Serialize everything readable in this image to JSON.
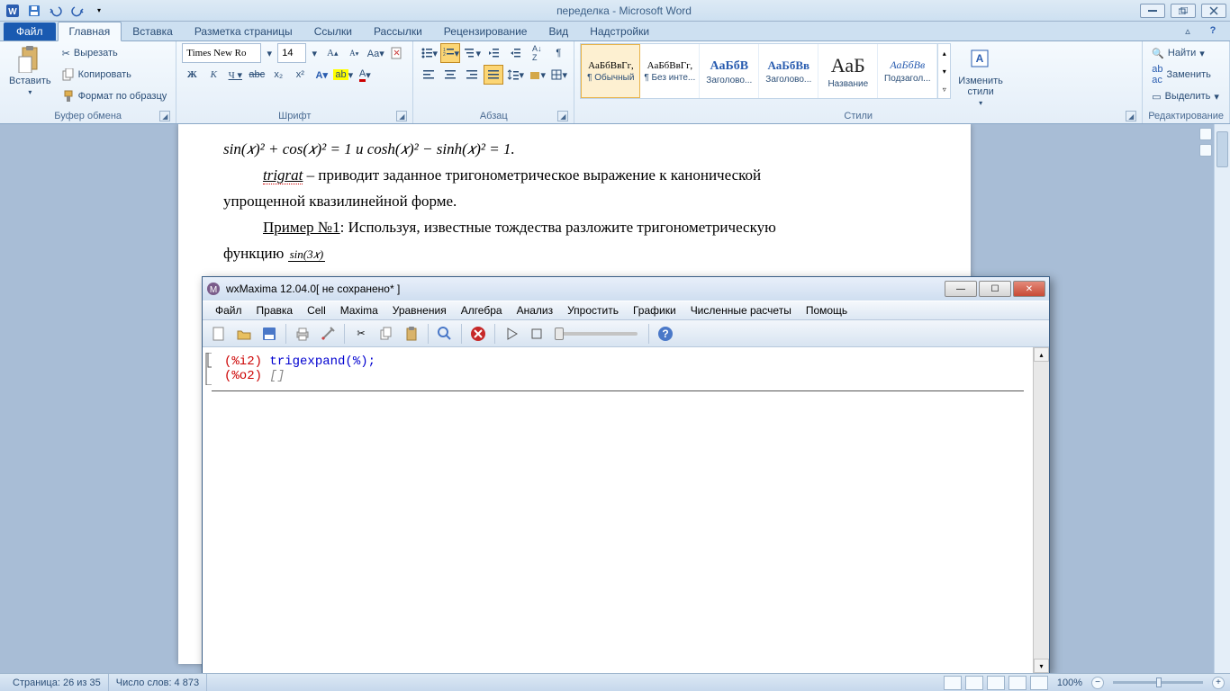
{
  "word": {
    "title": "переделка  -  Microsoft Word",
    "tabs": {
      "file": "Файл",
      "list": [
        "Главная",
        "Вставка",
        "Разметка страницы",
        "Ссылки",
        "Рассылки",
        "Рецензирование",
        "Вид",
        "Надстройки"
      ],
      "active": 0
    },
    "clipboard": {
      "paste": "Вставить",
      "cut": "Вырезать",
      "copy": "Копировать",
      "format_painter": "Формат по образцу",
      "group": "Буфер обмена"
    },
    "font": {
      "name": "Times New Ro",
      "size": "14",
      "group": "Шрифт"
    },
    "paragraph": {
      "group": "Абзац"
    },
    "styles": {
      "items": [
        {
          "preview": "АаБбВвГг,",
          "label": "¶ Обычный",
          "cls": "font-size:11px"
        },
        {
          "preview": "АаБбВвГг,",
          "label": "¶ Без инте...",
          "cls": "font-size:11px"
        },
        {
          "preview": "АаБбВ",
          "label": "Заголово...",
          "cls": "font-size:14px;color:#2a5db0;font-weight:bold"
        },
        {
          "preview": "АаБбВв",
          "label": "Заголово...",
          "cls": "font-size:13px;color:#2a5db0;font-weight:bold"
        },
        {
          "preview": "АаБ",
          "label": "Название",
          "cls": "font-size:22px;color:#222"
        },
        {
          "preview": "АаБбВв",
          "label": "Подзагол...",
          "cls": "font-size:12px;color:#2a5db0;font-style:italic"
        }
      ],
      "change": "Изменить\nстили",
      "group": "Стили"
    },
    "editing": {
      "find": "Найти",
      "replace": "Заменить",
      "select": "Выделить",
      "group": "Редактирование"
    },
    "document": {
      "line1": "sin(𝑥)² + cos(𝑥)² = 1 и cosh(𝑥)² − sinh(𝑥)² = 1.",
      "line2a": "trigrat",
      "line2b": " – приводит заданное тригонометрическое выражение к канонической",
      "line3": "упрощенной квазилинейной форме.",
      "line4a": "Пример №1",
      "line4b": ": Используя, известные тождества разложите тригонометрическую",
      "line5a": "функцию ",
      "line5frac_top": "sin(3𝑥)"
    },
    "statusbar": {
      "page": "Страница: 26 из 35",
      "words": "Число слов: 4 873",
      "zoom": "100%"
    }
  },
  "maxima": {
    "title": "wxMaxima 12.04.0[ не сохранено* ]",
    "menus": [
      "Файл",
      "Правка",
      "Cell",
      "Maxima",
      "Уравнения",
      "Алгебра",
      "Анализ",
      "Упростить",
      "Графики",
      "Численные расчеты",
      "Помощь"
    ],
    "input_label": "(%i2)",
    "input_code": " trigexpand(%);",
    "output_label": "(%o2)",
    "output_value": " []"
  }
}
